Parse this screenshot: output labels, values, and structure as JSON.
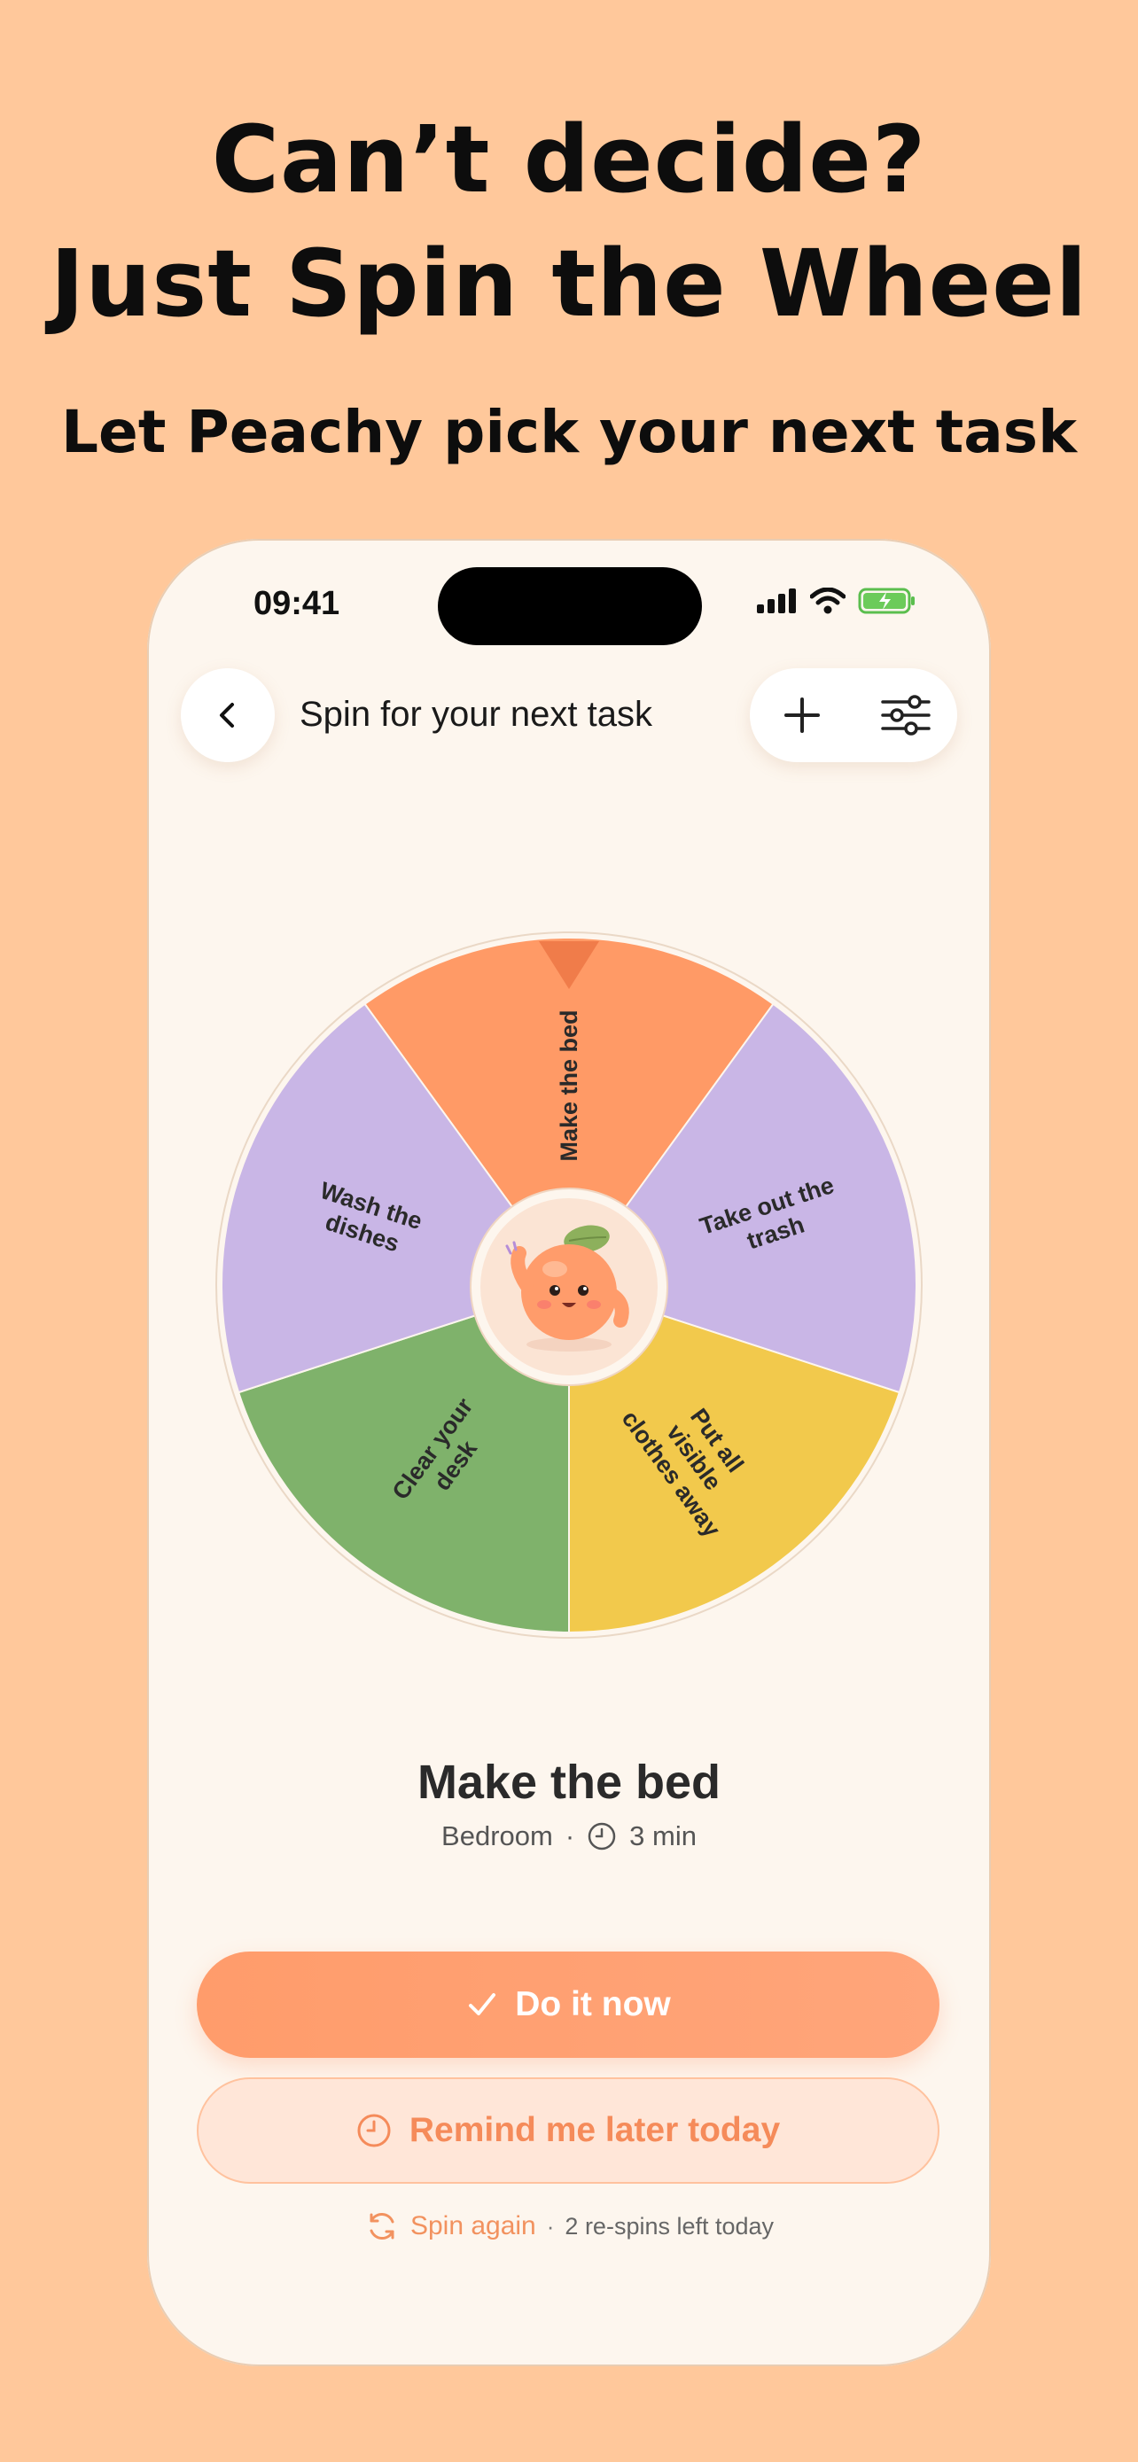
{
  "promo": {
    "line1": "Can’t decide?",
    "line2": "Just Spin the Wheel",
    "subtitle": "Let Peachy pick your next task"
  },
  "status_bar": {
    "time": "09:41"
  },
  "header": {
    "title": "Spin for your next task"
  },
  "wheel": {
    "segments": [
      {
        "label": "Make the bed",
        "color": "#FF9A66"
      },
      {
        "label": "Take out the trash",
        "color": "#C9B6E6"
      },
      {
        "label": "Put all visible clothes away",
        "color": "#F2C94C"
      },
      {
        "label": "Clear your desk",
        "color": "#7FB26B"
      },
      {
        "label": "Wash the dishes",
        "color": "#C9B6E6"
      }
    ],
    "pointer_color": "#F07C4A",
    "selected": "Make the bed"
  },
  "result": {
    "title": "Make the bed",
    "room": "Bedroom",
    "separator": "·",
    "duration": "3 min"
  },
  "actions": {
    "primary_label": "Do it now",
    "secondary_label": "Remind me later today",
    "spin_again_label": "Spin again",
    "spin_separator": "·",
    "respins_left": "2 re-spins left today"
  },
  "colors": {
    "accent": "#FF9C6B",
    "background": "#FFC89B",
    "card": "#FDF6EE"
  }
}
